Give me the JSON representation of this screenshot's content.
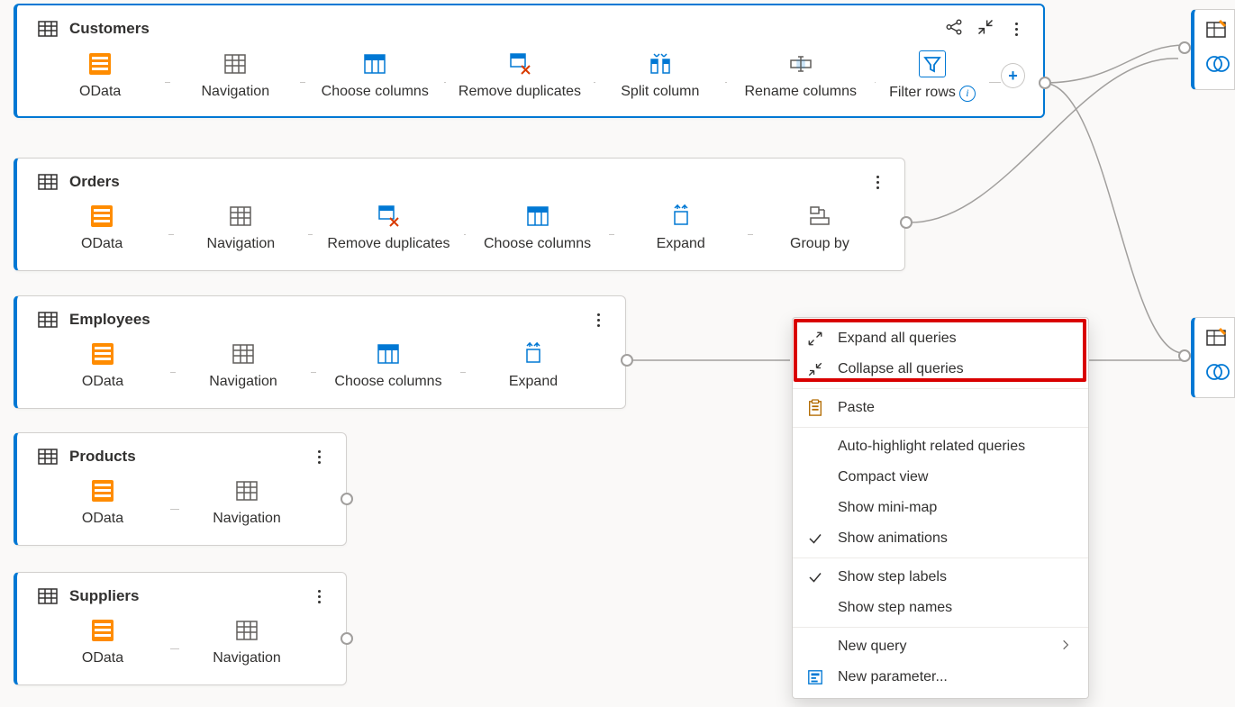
{
  "queries": {
    "customers": {
      "title": "Customers",
      "steps": [
        "OData",
        "Navigation",
        "Choose columns",
        "Remove duplicates",
        "Split column",
        "Rename columns",
        "Filter rows"
      ]
    },
    "orders": {
      "title": "Orders",
      "steps": [
        "OData",
        "Navigation",
        "Remove duplicates",
        "Choose columns",
        "Expand",
        "Group by"
      ]
    },
    "employees": {
      "title": "Employees",
      "steps": [
        "OData",
        "Navigation",
        "Choose columns",
        "Expand"
      ]
    },
    "products": {
      "title": "Products",
      "steps": [
        "OData",
        "Navigation"
      ]
    },
    "suppliers": {
      "title": "Suppliers",
      "steps": [
        "OData",
        "Navigation"
      ]
    }
  },
  "partials": {
    "top": "T",
    "bottom": "T"
  },
  "contextMenu": {
    "expandAll": "Expand all queries",
    "collapseAll": "Collapse all queries",
    "paste": "Paste",
    "autoHighlight": "Auto-highlight related queries",
    "compactView": "Compact view",
    "showMiniMap": "Show mini-map",
    "showAnimations": "Show animations",
    "showStepLabels": "Show step labels",
    "showStepNames": "Show step names",
    "newQuery": "New query",
    "newParameter": "New parameter..."
  }
}
